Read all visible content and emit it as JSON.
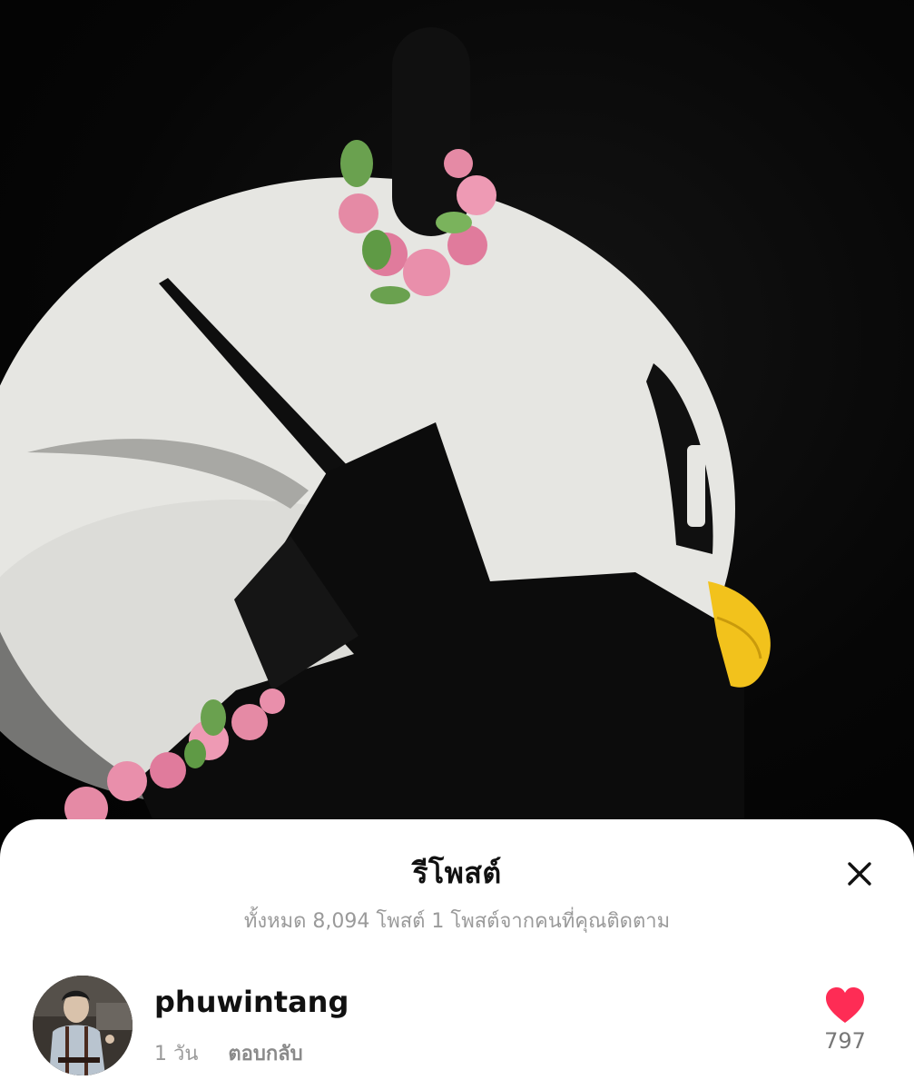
{
  "video": {
    "subject_icon": "penguin-mascot-head-with-flower-wreath"
  },
  "sheet": {
    "title": "รีโพสต์",
    "subtitle": "ทั้งหมด 8,094 โพสต์ 1 โพสต์จากคนที่คุณติดตาม",
    "close_icon": "close-icon"
  },
  "repost": {
    "username": "phuwintang",
    "time": "1 วัน",
    "reply_label": "ตอบกลับ",
    "like_count": "797",
    "like_color": "#fe2c55",
    "liked": true
  }
}
